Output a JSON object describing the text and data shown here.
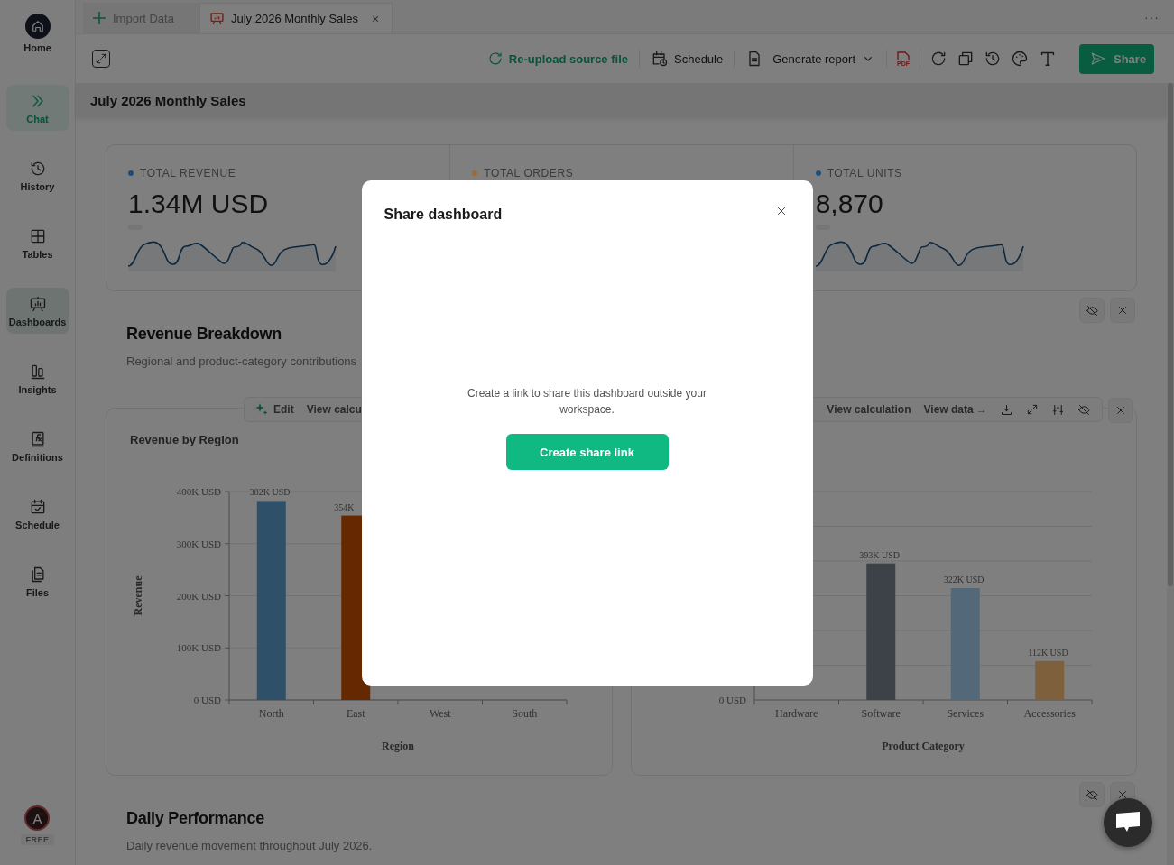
{
  "sidebar": {
    "items": [
      {
        "label": "Home",
        "kind": "home",
        "selected": false,
        "accent": false
      },
      {
        "label": "Chat",
        "kind": "chat",
        "selected": true,
        "accent": true
      },
      {
        "label": "History",
        "kind": "history",
        "selected": false,
        "accent": false
      },
      {
        "label": "Tables",
        "kind": "tables",
        "selected": false,
        "accent": false
      },
      {
        "label": "Dashboards",
        "kind": "dashboards",
        "selected": true,
        "accent": false
      },
      {
        "label": "Insights",
        "kind": "insights",
        "selected": false,
        "accent": false
      },
      {
        "label": "Definitions",
        "kind": "definitions",
        "selected": false,
        "accent": false
      },
      {
        "label": "Schedule",
        "kind": "schedule",
        "selected": false,
        "accent": false
      },
      {
        "label": "Files",
        "kind": "files",
        "selected": false,
        "accent": false
      }
    ],
    "user": {
      "initial": "A",
      "plan": "FREE"
    }
  },
  "tabs": [
    {
      "label": "Import Data",
      "kind": "add",
      "selected": false
    },
    {
      "label": "July 2026 Monthly Sales",
      "kind": "dashboard",
      "selected": true,
      "close": "×"
    }
  ],
  "tab_menu": "···",
  "toolbar": {
    "reupload": "Re-upload source file",
    "schedule": "Schedule",
    "generate_report": "Generate report",
    "pdf": "PDF",
    "share": "Share"
  },
  "dashboard": {
    "title": "July 2026 Monthly Sales",
    "kpis": [
      {
        "label": "TOTAL REVENUE",
        "value": "1.34M USD",
        "color": "#1a4e7a"
      },
      {
        "label": "TOTAL ORDERS",
        "color": "#a06a35"
      },
      {
        "label": "TOTAL UNITS",
        "value": "8,870",
        "color": "#1d5080"
      }
    ],
    "sections": [
      {
        "title": "Revenue Breakdown",
        "subtitle": "Regional and product-category contributions"
      },
      {
        "title": "Daily Performance",
        "subtitle": "Daily revenue movement throughout July 2026."
      }
    ],
    "charts": [
      {
        "actions": [
          {
            "label": "Edit",
            "kind": "ai"
          },
          {
            "label": "View calcu",
            "kind": "text"
          }
        ],
        "show_tools": false,
        "closable": false,
        "chart_data": {
          "type": "bar",
          "title": "Revenue by Region",
          "xlabel": "Region",
          "ylabel": "Revenue",
          "categories": [
            "North",
            "East",
            "West",
            "South"
          ],
          "values": [
            382000,
            354000,
            null,
            null
          ],
          "colors": [
            "#5ca0d0",
            "#cc5000",
            null,
            null
          ],
          "grid": true,
          "ylim": [
            0,
            400000
          ],
          "yticks": [
            {
              "value": 0,
              "label": "0 USD"
            },
            {
              "value": 100000,
              "label": "100K USD"
            },
            {
              "value": 200000,
              "label": "200K USD"
            },
            {
              "value": 300000,
              "label": "300K USD"
            },
            {
              "value": 400000,
              "label": "400K USD"
            }
          ],
          "value_labels": [
            "382K USD",
            "354K",
            null,
            null
          ]
        }
      },
      {
        "actions": [
          {
            "label": "View calculation",
            "kind": "text"
          },
          {
            "label": "View data →",
            "kind": "text"
          }
        ],
        "show_tools": true,
        "closable": true,
        "chart_data": {
          "type": "bar",
          "xlabel": "Product Category",
          "categories": [
            "Hardware",
            "Software",
            "Services",
            "Accessories"
          ],
          "values": [
            null,
            393000,
            322000,
            112000
          ],
          "colors": [
            null,
            "#7a8290",
            "#a6d0f0",
            "#ffc078"
          ],
          "grid": true,
          "annotations": [
            "0 USD"
          ],
          "value_labels": [
            null,
            "393K USD",
            "322K USD",
            "112K USD"
          ]
        }
      }
    ]
  },
  "modal": {
    "title": "Share dashboard",
    "message": "Create a link to share this dashboard outside your workspace.",
    "button": "Create share link"
  }
}
